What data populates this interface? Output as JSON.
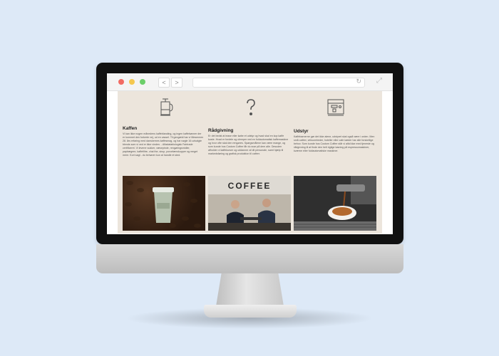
{
  "browser": {
    "back_label": "<",
    "forward_label": ">",
    "reload_icon": "reload-icon",
    "expand_icon": "expand-icon"
  },
  "columns": [
    {
      "icon": "french-press-icon",
      "title": "Kaffen",
      "text": "Vi kan ikke nogen månedens kaffeblanding, og ingen kaffebønner der er kommet den forkerte vej, ud en vassel. Til gengæld har vi lillesmmen 28. års erfaring med danskernes kaffesmag, og har nøgle 16 udvalgte blends som vi ved er ikke vinden. - Alfadatabiologisk Fairtrade certificeret. Vi leverer sukker, væsepinde, rengøringsmidler, papbægere, kaffefiltre, chai the, sirup, porcelænskopper og meget mere. Kort sagt - du behøver kun at handle et sted."
    },
    {
      "icon": "question-mark-icon",
      "title": "Rådgivning",
      "text": "Er det bedst at lease eller købe et udstyr og hvad skal en kop kaffe koste. Hvad er fordele og ulemper ved en fuldautomatisk kaffemaskine og hvor ofte skal den rengøres. Spørgsmålene kan være mange, og som kunde hos Custom Coffee får du svar på dem alle. Desuden afholder vi kaffekurser og uddanner af dit personale, samt hjælp til markedsføring og grafisk produktion til caféer."
    },
    {
      "icon": "espresso-machine-icon",
      "title": "Udstyr",
      "text": "Kaffebarnerne gør det ikke alene, udstyret skal også være i orden. Men små caféer, virksomheder, hoteller eller cafe kæder har alle forskellige behov. Som kunde hos Custom Coffee står vi altid klar med tjeneste og rådgivning til at finde den helt rigtige løsning på espressomaskiner, kværne eller fuldautomatiske maskiner."
    }
  ],
  "photos": [
    {
      "name": "coffee-cup-photo",
      "cup_label": "CUSTOM COFFEE"
    },
    {
      "name": "coffee-shop-photo",
      "sign": "COFFEE"
    },
    {
      "name": "espresso-pour-photo"
    }
  ]
}
